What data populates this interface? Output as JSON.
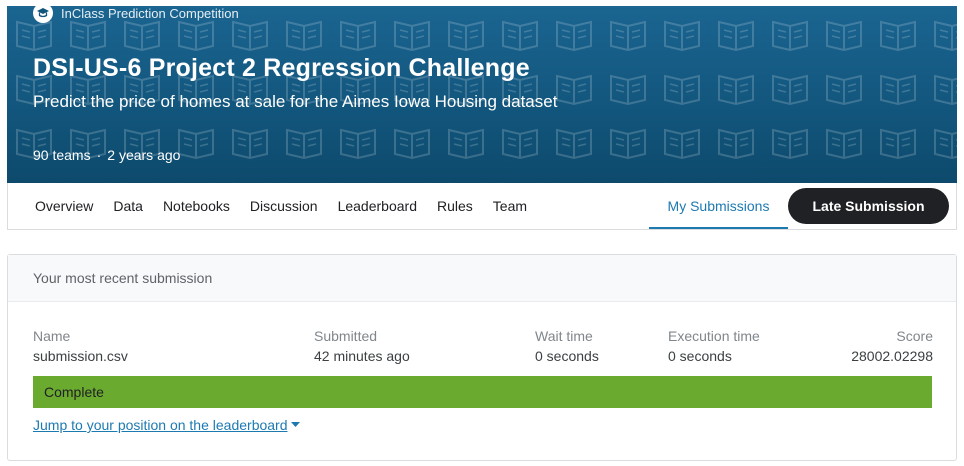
{
  "competition": {
    "type_label": "InClass Prediction Competition",
    "title": "DSI-US-6 Project 2 Regression Challenge",
    "subtitle": "Predict the price of homes at sale for the Aimes Iowa Housing dataset",
    "teams": "90 teams",
    "separator": "·",
    "age": "2 years ago"
  },
  "tabs": [
    "Overview",
    "Data",
    "Notebooks",
    "Discussion",
    "Leaderboard",
    "Rules",
    "Team"
  ],
  "active_tab": "My Submissions",
  "late_submission_label": "Late Submission",
  "submission": {
    "header": "Your most recent submission",
    "name_label": "Name",
    "name_value": "submission.csv",
    "submitted_label": "Submitted",
    "submitted_value": "42 minutes ago",
    "wait_label": "Wait time",
    "wait_value": "0 seconds",
    "exec_label": "Execution time",
    "exec_value": "0 seconds",
    "score_label": "Score",
    "score_value": "28002.02298",
    "status": "Complete",
    "status_color": "#6aaa2f",
    "jump_link": "Jump to your position on the leaderboard"
  },
  "icons": {
    "competition_type": "graduation-cap-icon",
    "jump_caret": "caret-down-icon"
  },
  "colors": {
    "banner": "#12557c",
    "accent": "#1d7ab1",
    "button": "#202124"
  }
}
